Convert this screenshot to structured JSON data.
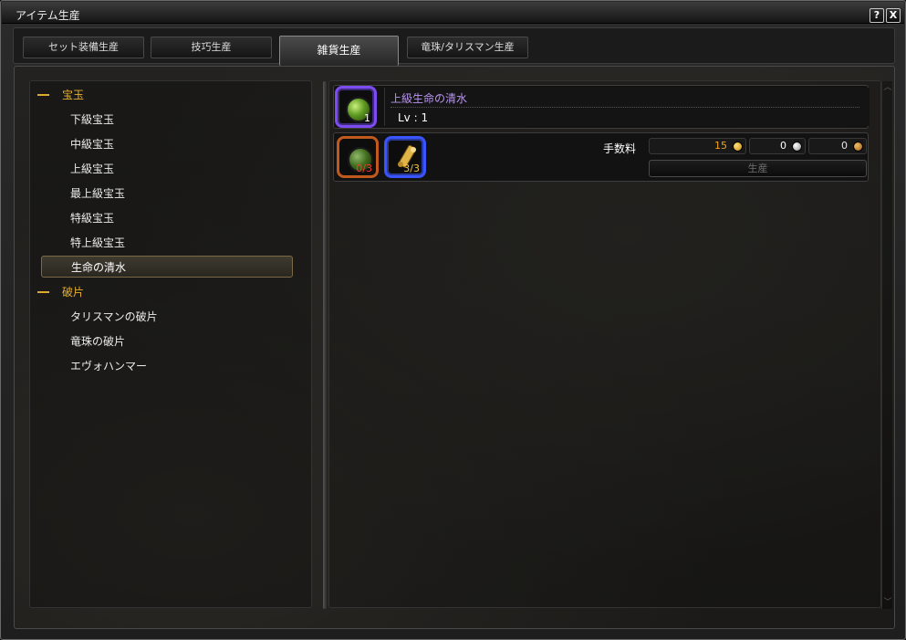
{
  "window": {
    "title": "アイテム生産",
    "help_label": "?",
    "close_label": "X"
  },
  "tabs": [
    {
      "label": "セット装備生産",
      "active": false
    },
    {
      "label": "技巧生産",
      "active": false
    },
    {
      "label": "雑貨生産",
      "active": true
    },
    {
      "label": "竜珠/タリスマン生産",
      "active": false
    }
  ],
  "categories": [
    {
      "label": "宝玉",
      "expanded_marker": "—",
      "items": [
        "下級宝玉",
        "中級宝玉",
        "上級宝玉",
        "最上級宝玉",
        "特級宝玉",
        "特上級宝玉",
        "生命の清水"
      ]
    },
    {
      "label": "破片",
      "expanded_marker": "—",
      "items": [
        "タリスマンの破片",
        "竜珠の破片",
        "エヴォハンマー"
      ]
    }
  ],
  "selected_item": "生命の清水",
  "result": {
    "name": "上級生命の清水",
    "level": "Lv : 1",
    "quantity": "1",
    "icon": "green-potion-icon"
  },
  "materials": [
    {
      "icon": "green-potion-icon",
      "count": "0/3",
      "count_color": "#ff3b2e",
      "frame_color": "#c0591e"
    },
    {
      "icon": "scroll-icon",
      "count": "3/3",
      "count_color": "#f0c34a",
      "frame_color": "#3a54ff"
    }
  ],
  "fee": {
    "label": "手数料",
    "gold": "15",
    "silver": "0",
    "copper": "0",
    "gold_color": "#f2a41c",
    "silver_color": "#ffffff",
    "copper_color": "#e6e6e6"
  },
  "produce_button": {
    "label": "生産",
    "enabled": false
  },
  "colors": {
    "category": "#e8b030",
    "result_name": "#b894ee",
    "accent_frame": "#7c6a47"
  }
}
